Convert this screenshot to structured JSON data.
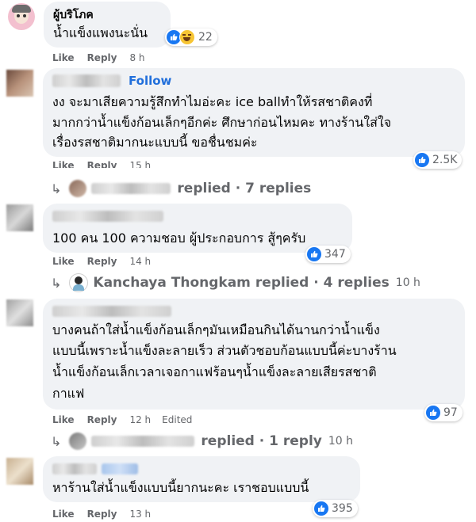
{
  "comments": [
    {
      "name": "ผู้บริโภค",
      "text": [
        "น้ำแข็งแพงนะนั่น"
      ],
      "actions": {
        "like": "Like",
        "reply": "Reply",
        "time": "8 h"
      },
      "reactions": {
        "count": "22",
        "types": [
          "like-icon",
          "haha-icon"
        ]
      }
    },
    {
      "follow": "Follow",
      "text": [
        "งง จะมาเสียความรู้สึกทำไมอ่ะคะ ice ballทำให้รสชาติคงที่",
        "มากกว่าน้ำแข็งก้อนเล็กๆอีกค่ะ ศึกษาก่อนไหมคะ ทางร้านใส่ใจ",
        "เรื่องรสชาติมากนะแบบนี้ ขอชื่นชมค่ะ"
      ],
      "actions": {
        "like": "Like",
        "reply": "Reply",
        "time": "15 h"
      },
      "reactions": {
        "count": "2.5K"
      },
      "replies": {
        "text": "replied · 7 replies"
      }
    },
    {
      "text": [
        "100 คน 100 ความชอบ ผู้ประกอบการ สู้ๆครับ"
      ],
      "actions": {
        "like": "Like",
        "reply": "Reply",
        "time": "14 h"
      },
      "reactions": {
        "count": "347"
      },
      "replies": {
        "name": "Kanchaya Thongkam",
        "text": "replied · 4 replies",
        "time": "10 h"
      }
    },
    {
      "text": [
        "บางคนถ้าใส่น้ำแข็งก้อนเล็กๆมันเหมือนกินได้นานกว่าน้ำแข็ง",
        "แบบนี้เพราะน้ำแข็งละลายเร็ว ส่วนตัวชอบก้อนแบบนี้ค่ะบางร้าน",
        "น้ำแข็งก้อนเล็กเวลาเจอกาแฟร้อนๆน้ำแข็งละลายเสียรสชาติ",
        "กาแฟ"
      ],
      "actions": {
        "like": "Like",
        "reply": "Reply",
        "time": "12 h",
        "edited": "Edited"
      },
      "reactions": {
        "count": "97"
      },
      "replies": {
        "text": "replied · 1 reply",
        "time": "10 h"
      }
    },
    {
      "text": [
        "หาร้านใส่น้ำแข็งแบบนี้ยากนะคะ เราชอบแบบนี้"
      ],
      "actions": {
        "like": "Like",
        "reply": "Reply",
        "time": "13 h"
      },
      "reactions": {
        "count": "395"
      }
    }
  ]
}
